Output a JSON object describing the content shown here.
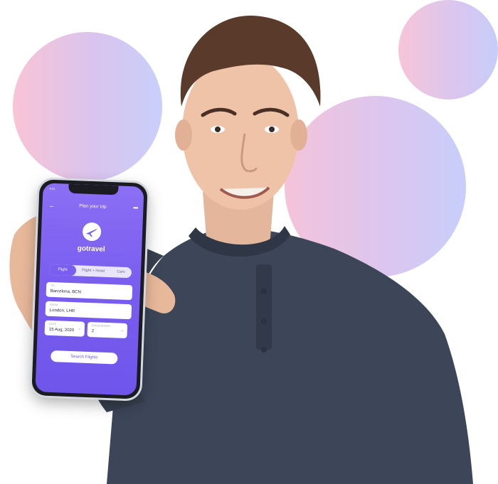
{
  "colors": {
    "accent": "#7a5ef0",
    "bubble_pink": "#f9c4d6",
    "bubble_lavender": "#c9cffb",
    "shirt": "#3c4658"
  },
  "phone": {
    "status_time": "9:41",
    "nav": {
      "back_icon": "arrow-left-icon",
      "title": "Plan your trip",
      "more_icon": "more-dots-icon"
    },
    "brand": {
      "logo_icon": "airplane-icon",
      "name": "gotravel"
    },
    "tabs": [
      {
        "label": "Flight",
        "selected": true
      },
      {
        "label": "Flight + Hotel",
        "selected": false
      },
      {
        "label": "Cars",
        "selected": false
      }
    ],
    "fields": {
      "to": {
        "label": "TO",
        "value": "Barcelona, BCN"
      },
      "from": {
        "label": "FROM",
        "value": "London, LHR"
      },
      "date": {
        "label": "DATE",
        "value": "15 Aug, 2020"
      },
      "passengers": {
        "label": "PASSENGERS",
        "value": "2"
      }
    },
    "search_button": "Search Flights"
  }
}
